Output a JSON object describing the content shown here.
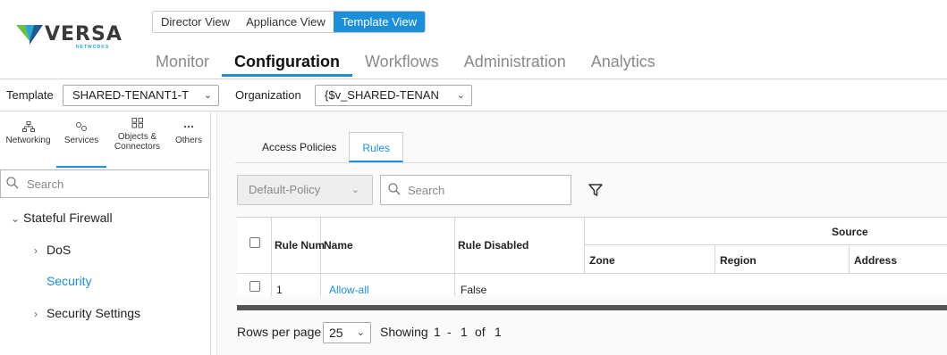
{
  "brand": {
    "name": "VERSA",
    "sub": "NETWORKS",
    "colors": {
      "teal": "#2aa7d6",
      "green": "#6abf4b",
      "navy": "#1f5a8a"
    }
  },
  "view_switch": {
    "items": [
      {
        "label": "Director View",
        "active": false
      },
      {
        "label": "Appliance View",
        "active": false
      },
      {
        "label": "Template View",
        "active": true
      }
    ]
  },
  "main_nav": {
    "items": [
      {
        "label": "Monitor",
        "active": false
      },
      {
        "label": "Configuration",
        "active": true
      },
      {
        "label": "Workflows",
        "active": false
      },
      {
        "label": "Administration",
        "active": false
      },
      {
        "label": "Analytics",
        "active": false
      }
    ]
  },
  "context": {
    "template_label": "Template",
    "template_value": "SHARED-TENANT1-T",
    "org_label": "Organization",
    "org_value": "{$v_SHARED-TENAN"
  },
  "left_tabs": [
    {
      "label": "Networking",
      "icon": "network-icon",
      "active": false
    },
    {
      "label": "Services",
      "icon": "services-icon",
      "active": true
    },
    {
      "label": "Objects & Connectors",
      "icon": "objects-icon",
      "active": false
    },
    {
      "label": "Others",
      "icon": "more-icon",
      "active": false
    }
  ],
  "left_search": {
    "placeholder": "Search"
  },
  "tree": {
    "root": "Stateful Firewall",
    "children": [
      {
        "label": "DoS",
        "expandable": true
      },
      {
        "label": "Security",
        "expandable": false,
        "selected": true
      },
      {
        "label": "Security Settings",
        "expandable": true
      }
    ]
  },
  "sub_tabs": [
    {
      "label": "Access Policies",
      "active": false
    },
    {
      "label": "Rules",
      "active": true
    }
  ],
  "policy_select": {
    "value": "Default-Policy"
  },
  "rules_search": {
    "placeholder": "Search"
  },
  "table": {
    "group_header": "Source",
    "columns": [
      "Rule Num",
      "Name",
      "Rule Disabled",
      "Zone",
      "Region",
      "Address"
    ],
    "rows": [
      {
        "rule_num": "1",
        "name": "Allow-all",
        "rule_disabled": "False"
      }
    ]
  },
  "pager": {
    "rows_per_page_label": "Rows per page",
    "rows_per_page": "25",
    "showing_label": "Showing",
    "from": "1",
    "dash": "-",
    "to": "1",
    "of_label": "of",
    "total": "1"
  },
  "accent_color": "#1d8fd8"
}
